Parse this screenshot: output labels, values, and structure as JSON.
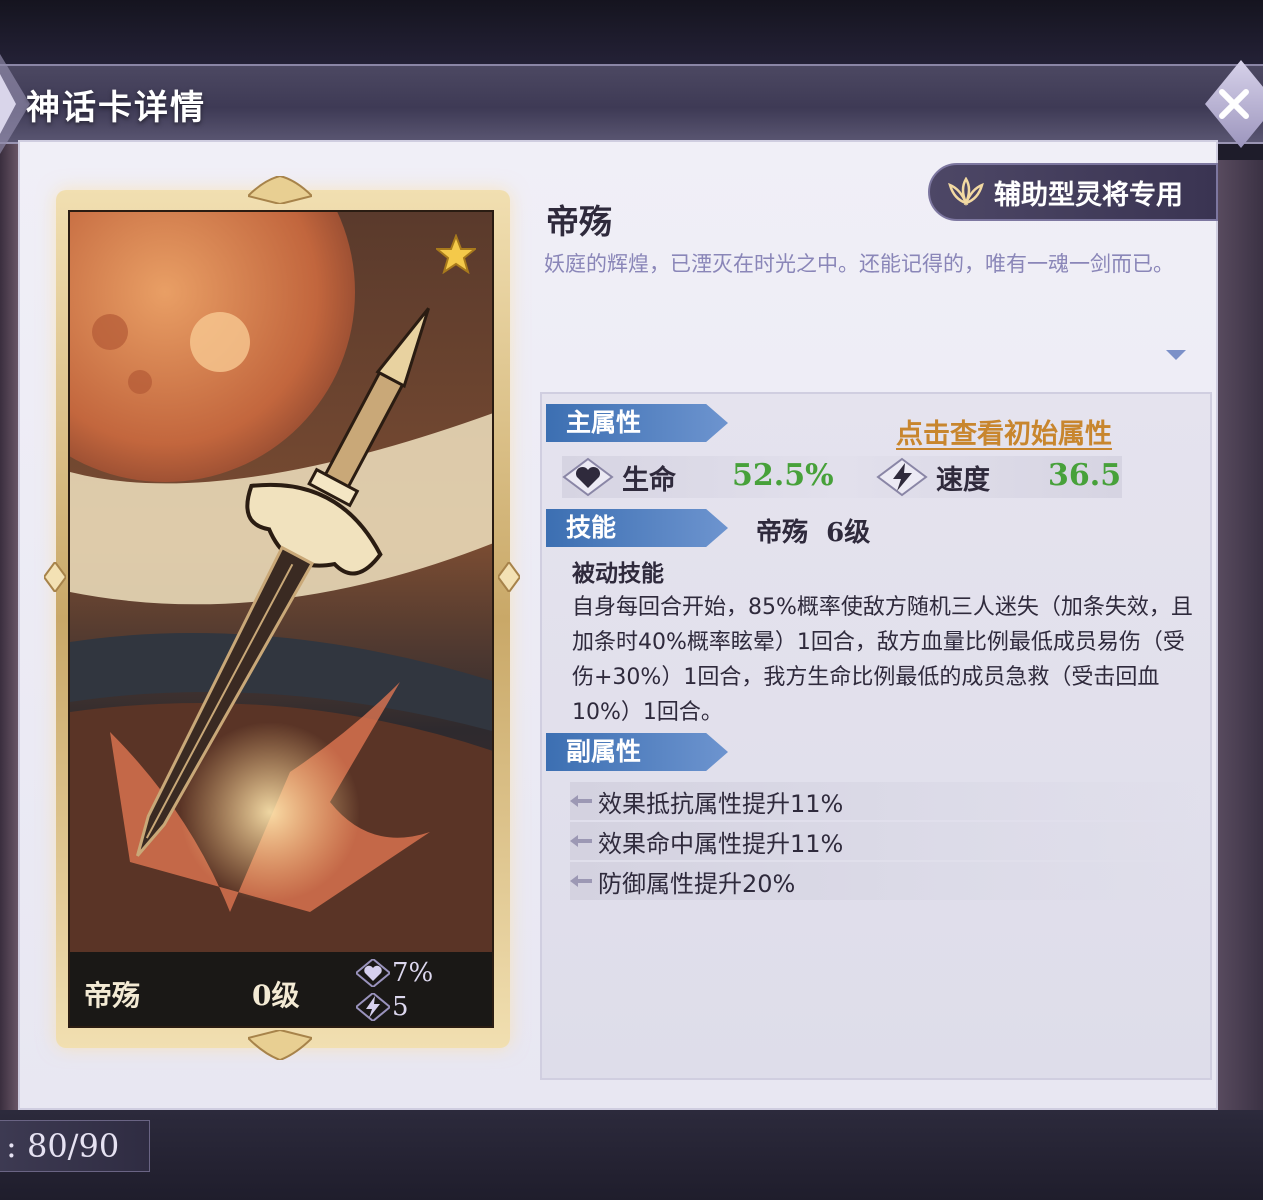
{
  "header": {
    "title": "神话卡详情",
    "close_icon": "close-icon"
  },
  "footer": {
    "counter": ": 80/90"
  },
  "card": {
    "name": "帝殇",
    "level": "0级",
    "stars": 1,
    "stats": [
      {
        "icon": "heart-icon",
        "value": "7%"
      },
      {
        "icon": "lightning-icon",
        "value": "5"
      }
    ]
  },
  "detail": {
    "exclusive_tag": "辅助型灵将专用",
    "name": "帝殇",
    "description": "妖庭的辉煌，已湮灭在时光之中。还能记得的，唯有一魂一剑而已。"
  },
  "main_attr": {
    "label": "主属性",
    "view_link": "点击查看初始属性",
    "stats": [
      {
        "icon": "heart-icon",
        "label": "生命",
        "value": "52.5%"
      },
      {
        "icon": "lightning-icon",
        "label": "速度",
        "value": "36.5"
      }
    ]
  },
  "skill": {
    "label": "技能",
    "name_level": "帝殇  6级",
    "type": "被动技能",
    "description": "自身每回合开始，85%概率使敌方随机三人迷失（加条失效，且加条时40%概率眩晕）1回合，敌方血量比例最低成员易伤（受伤+30%）1回合，我方生命比例最低的成员急救（受击回血10%）1回合。"
  },
  "sub_attr": {
    "label": "副属性",
    "items": [
      "效果抵抗属性提升11%",
      "效果命中属性提升11%",
      "防御属性提升20%"
    ]
  },
  "colors": {
    "accent_blue": "#3c6fb2",
    "value_green": "#47a13a",
    "link_gold": "#c8862e",
    "desc_purple": "#8a86b8"
  }
}
